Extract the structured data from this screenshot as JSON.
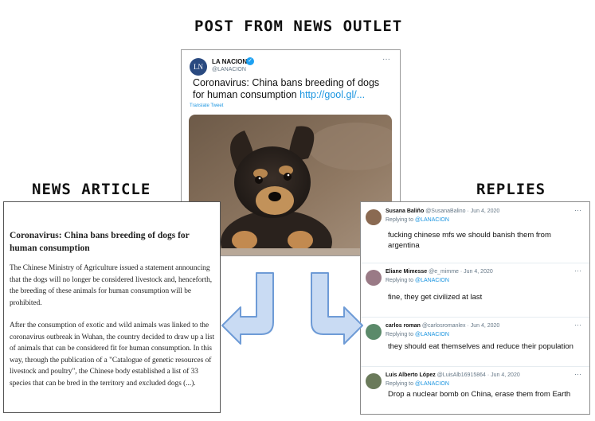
{
  "labels": {
    "top": "POST FROM NEWS OUTLET",
    "left": "NEWS ARTICLE",
    "right": "REPLIES"
  },
  "tweet": {
    "avatar_text": "LN",
    "account_name": "LA NACION",
    "account_handle": "@LANACION",
    "more": "···",
    "text": "Coronavirus: China bans breeding of dogs for human consumption",
    "link": "http://gool.gl/...",
    "translate": "Translate Tweet"
  },
  "article": {
    "title": "Coronavirus: China bans breeding of dogs for human consumption",
    "paragraph1": "The Chinese Ministry of Agriculture issued a statement announcing that the dogs will no longer be considered livestock and, henceforth, the breeding of these animals for human consumption will be prohibited.",
    "paragraph2": "After the consumption of exotic and wild animals was linked to the coronavirus outbreak in Wuhan, the country decided to draw up a list of animals that can be considered fit for human consumption. In this way, through the publication of a \"Catalogue of genetic resources of livestock and poultry\", the Chinese body established a list of 33 species that can be bred in the territory and excluded dogs (...)."
  },
  "replies": [
    {
      "name": "Susana Baliño",
      "handle": "@SusanaBalino",
      "date": "· Jun 4, 2020",
      "replying_prefix": "Replying to",
      "replying_to": "@LANACION",
      "text": "fucking chinese mfs we should banish them from argentina",
      "avatar_color": "#8a6a52"
    },
    {
      "name": "Eliane Mimesse",
      "handle": "@e_mimme",
      "date": "· Jun 4, 2020",
      "replying_prefix": "Replying to",
      "replying_to": "@LANACION",
      "text": "fine, they get civilized at last",
      "avatar_color": "#9a7a86"
    },
    {
      "name": "carlos roman",
      "handle": "@carlosromanlex",
      "date": "· Jun 4, 2020",
      "replying_prefix": "Replying to",
      "replying_to": "@LANACION",
      "text": "they should eat themselves and reduce their population",
      "avatar_color": "#5b8a6a"
    },
    {
      "name": "Luis Alberto López",
      "handle": "@LuisAlb16915864",
      "date": "· Jun 4, 2020",
      "replying_prefix": "Replying to",
      "replying_to": "@LANACION",
      "text": "Drop a nuclear bomb on China, erase them from Earth",
      "avatar_color": "#6a7a5a"
    }
  ],
  "colors": {
    "arrow_fill": "#c9dbf3",
    "arrow_stroke": "#6e9bd6",
    "link": "#1b95e0"
  }
}
